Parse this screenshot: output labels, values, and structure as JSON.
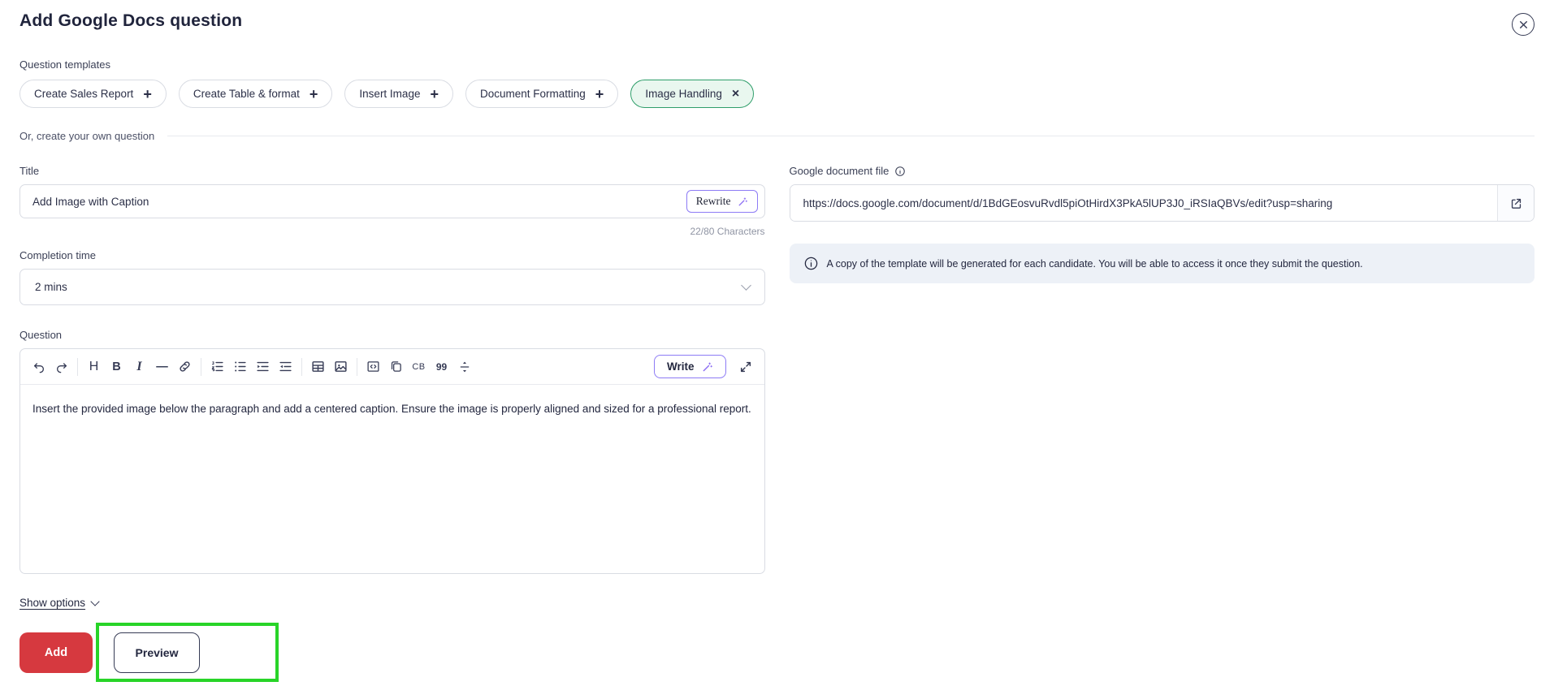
{
  "header": {
    "title": "Add Google Docs question"
  },
  "templates": {
    "label": "Question templates",
    "chips": [
      {
        "label": "Create Sales Report",
        "icon": "plus-icon",
        "selected": false
      },
      {
        "label": "Create Table & format",
        "icon": "plus-icon",
        "selected": false
      },
      {
        "label": "Insert Image",
        "icon": "plus-icon",
        "selected": false
      },
      {
        "label": "Document Formatting",
        "icon": "plus-icon",
        "selected": false
      },
      {
        "label": "Image Handling",
        "icon": "x-icon",
        "selected": true
      }
    ]
  },
  "own_question_divider": "Or, create your own question",
  "title_field": {
    "label": "Title",
    "value": "Add Image with Caption",
    "rewrite_label": "Rewrite",
    "char_count": "22/80 Characters"
  },
  "completion_time": {
    "label": "Completion time",
    "value": "2 mins"
  },
  "question": {
    "label": "Question",
    "write_label": "Write",
    "text": "Insert the provided image below the paragraph and add a centered caption. Ensure the image is properly aligned and sized for a professional report.",
    "toolbar_glyphs": {
      "heading": "H",
      "bold": "B",
      "italic": "I",
      "hr": "—",
      "code_badge": "CB",
      "blockquote": "99"
    },
    "toolbar_icons": [
      "undo",
      "redo",
      "heading",
      "bold",
      "italic",
      "horizontal-rule",
      "link",
      "ordered-list",
      "unordered-list",
      "indent-increase",
      "indent-decrease",
      "table",
      "insert-image",
      "code-block",
      "copy",
      "code-badge",
      "blockquote",
      "expand-vertical",
      "write-ai",
      "fullscreen"
    ]
  },
  "google_doc": {
    "label": "Google document file",
    "url": "https://docs.google.com/document/d/1BdGEosvuRvdl5piOtHirdX3PkA5lUP3J0_iRSIaQBVs/edit?usp=sharing",
    "note": "A copy of the template will be generated for each candidate. You will be able to access it once they submit the question."
  },
  "footer": {
    "show_options": "Show options",
    "add_label": "Add",
    "preview_label": "Preview"
  },
  "colors": {
    "accent_red": "#d6393f",
    "highlight_green": "#28d428",
    "chip_selected_border": "#2f9e6a",
    "chip_selected_bg": "#e9f7ef",
    "accent_purple": "#8d7bf5",
    "text_navy": "#23273f",
    "info_bg": "#edf1f7"
  }
}
